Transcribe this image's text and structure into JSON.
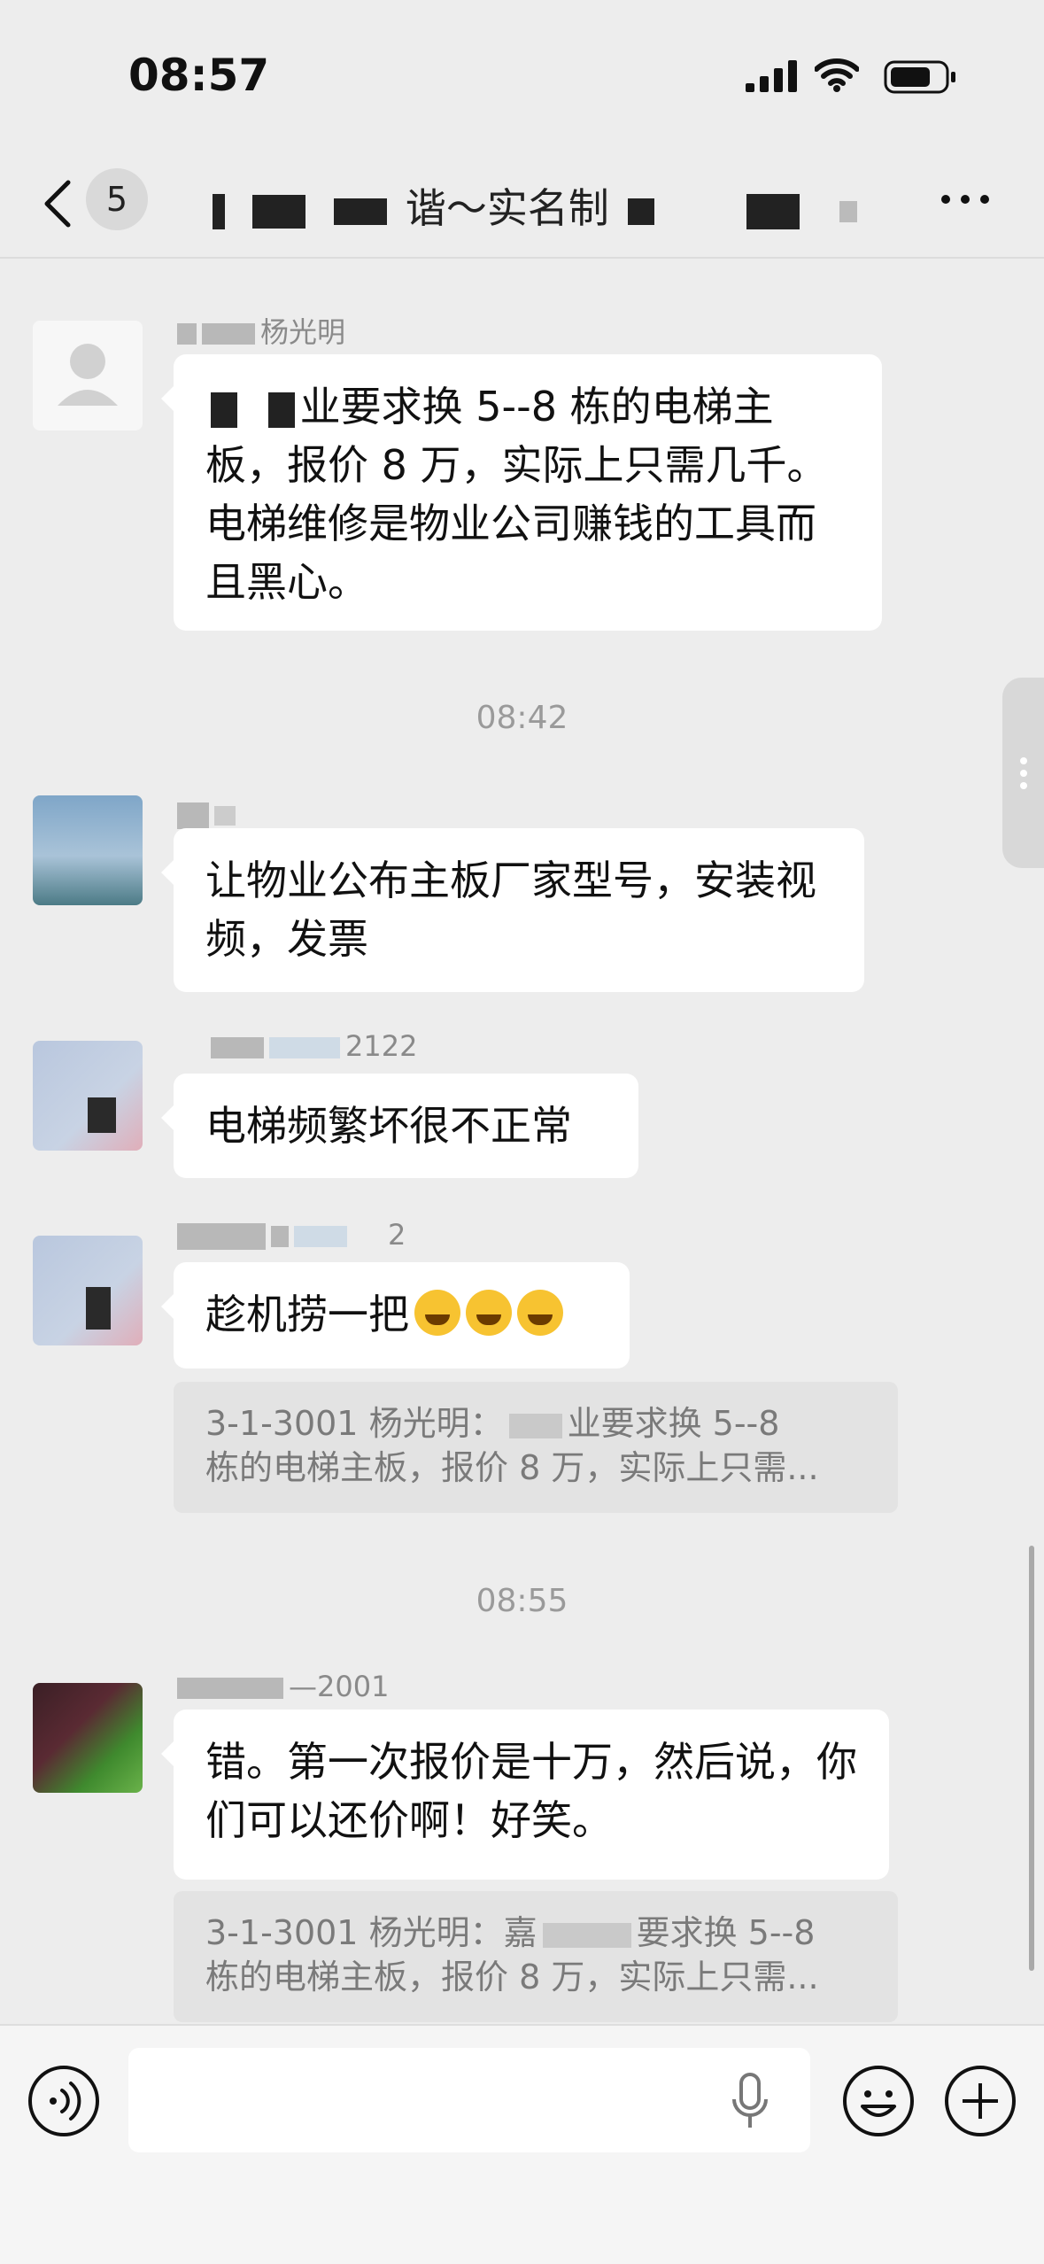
{
  "status_bar": {
    "time": "08:57"
  },
  "nav": {
    "unread_count": "5",
    "title": "谐～实名制"
  },
  "messages": [
    {
      "sender": "杨光明",
      "text": "业要求换 5--8 栋的电梯主板，报价 8 万，实际上只需几千。电梯维修是物业公司赚钱的工具而且黑心。"
    },
    {
      "sender": "",
      "text": "让物业公布主板厂家型号，安装视频，发票"
    },
    {
      "sender": "2122",
      "text": "电梯频繁坏很不正常"
    },
    {
      "sender": "2",
      "text": "趁机捞一把",
      "quote_line1": "3-1-3001 杨光明：",
      "quote_line1b": "业要求换 5--8",
      "quote_line2": "栋的电梯主板，报价 8 万，实际上只需..."
    },
    {
      "sender": "—2001",
      "text": "错。第一次报价是十万，然后说，你们可以还价啊！好笑。",
      "quote_line1": "3-1-3001 杨光明：嘉",
      "quote_line1b": "要求换 5--8",
      "quote_line2": "栋的电梯主板，报价 8 万，实际上只需..."
    }
  ],
  "timestamps": [
    "08:42",
    "08:55"
  ],
  "icons": {
    "back": "chevron-left-icon",
    "more": "more-icon",
    "voice": "voice-icon",
    "mic": "microphone-icon",
    "emoji": "emoji-icon",
    "plus": "plus-icon"
  }
}
